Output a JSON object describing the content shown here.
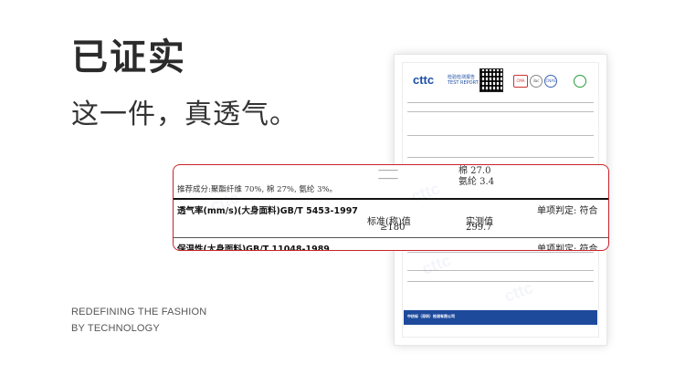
{
  "headline": "已证实",
  "subline": "这一件，真透气。",
  "english": {
    "line1": "REDEFINING THE FASHION",
    "line2": "BY TECHNOLOGY"
  },
  "document": {
    "logo": "cttc",
    "logo_sub_cn": "检验检测报告",
    "logo_sub_en": "TEST REPORT",
    "badges": [
      "CMA",
      "ilac",
      "CNAS"
    ],
    "footer_org": "中纺标（深圳）检测有限公司"
  },
  "callout": {
    "top_value_1": "棉 27.0",
    "top_value_2": "氨纶 3.4",
    "dash": "———",
    "composition": "推荐成分:聚酯纤维 70%, 棉 27%, 氨纶 3%。",
    "test_name": "透气率(mm/s)(大身面料)GB/T 5453-1997",
    "judgement": "单项判定: 符合",
    "std_label": "标准(称)值",
    "act_label": "实测值",
    "std_value": "≥180",
    "act_value": "299.7",
    "next_test": "保温性(大身面料)GB/T 11048-1989",
    "next_judgement": "单项判定: 符合"
  }
}
